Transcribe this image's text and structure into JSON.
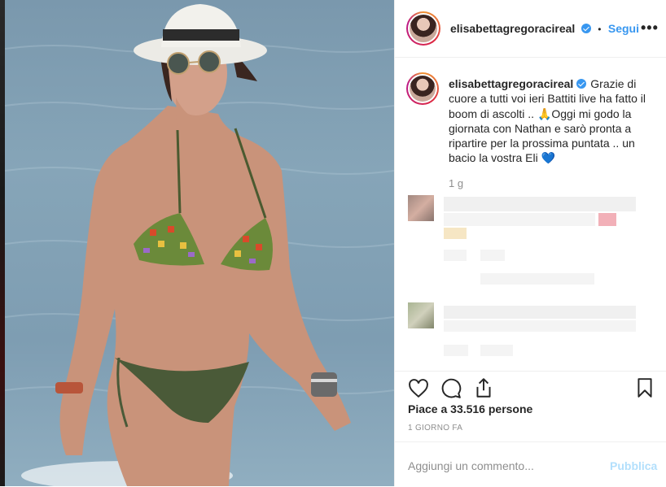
{
  "photo": {
    "alt_subject": ""
  },
  "post": {
    "username": "elisabettagregoracireal",
    "verified": true,
    "follow_label": "Segui",
    "separator": "•",
    "more_icon": "more-options-icon"
  },
  "caption": {
    "username": "elisabettagregoracireal",
    "text": "Grazie di cuore a tutti voi ieri Battiti live ha fatto il boom di ascolti .. 🙏Oggi mi godo la giornata con Nathan e sarò pronta a ripartire per la prossima puntata .. un bacio la vostra Eli 💙",
    "time": "1 g"
  },
  "actions": {
    "icons": [
      "heart-icon",
      "comment-icon",
      "share-icon",
      "bookmark-icon"
    ],
    "likes": "Piace a 33.516 persone",
    "date": "1 GIORNO FA"
  },
  "comment": {
    "placeholder": "Aggiungi un commento...",
    "publish": "Pubblica"
  },
  "colors": {
    "accent": "#3897f0",
    "text": "#262626",
    "muted": "#8e8e8e",
    "publish_disabled": "#b2dffc"
  }
}
